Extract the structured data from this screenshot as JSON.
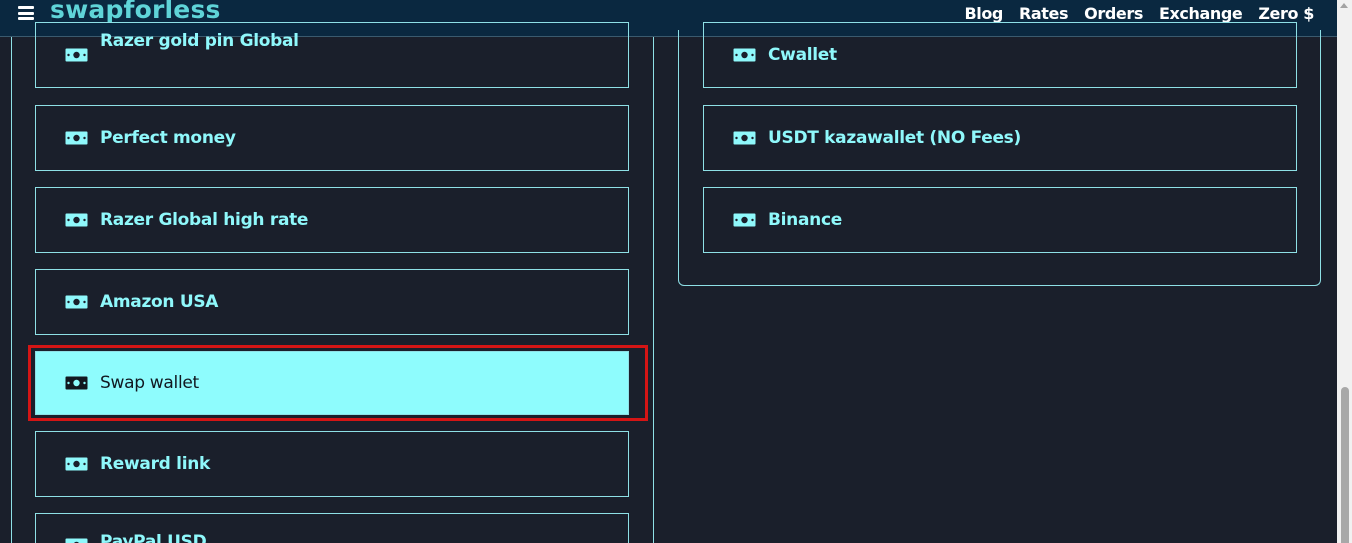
{
  "brand": "swapforless",
  "nav": [
    "Blog",
    "Rates",
    "Orders",
    "Exchange",
    "Zero $"
  ],
  "left_items": [
    {
      "label": "Razer gold pin Global"
    },
    {
      "label": "Perfect money"
    },
    {
      "label": "Razer Global high rate"
    },
    {
      "label": "Amazon USA"
    },
    {
      "label": "Swap wallet",
      "selected": true
    },
    {
      "label": "Reward link"
    },
    {
      "label": "PayPal USD"
    }
  ],
  "right_items": [
    {
      "label": "Cwallet"
    },
    {
      "label": "USDT kazawallet (NO Fees)"
    },
    {
      "label": "Binance"
    }
  ],
  "icon": "money-bill-icon",
  "colors": {
    "accent": "#8ff8fb",
    "selected_bg": "#8efcfd",
    "background": "#1a1f2b",
    "navbar": "#0a2840",
    "highlight": "#d41515"
  }
}
